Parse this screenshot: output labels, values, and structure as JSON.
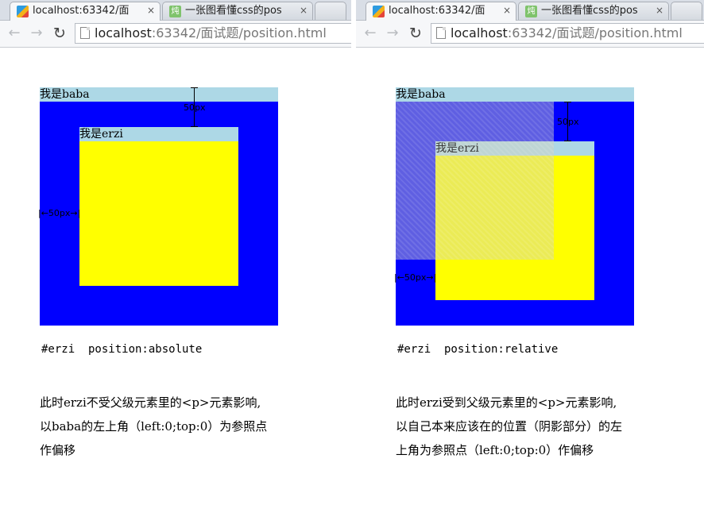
{
  "left": {
    "tabs": [
      {
        "title": "localhost:63342/面",
        "close": "×",
        "favicon": "webstorm-icon"
      },
      {
        "title": "一张图看懂css的pos",
        "close": "×",
        "favicon": "chi-icon",
        "favicon_text": "炖"
      }
    ],
    "url": {
      "host": "localhost",
      "rest": ":63342/面试题/position.html"
    },
    "baba_label": "我是baba",
    "erzi_label": "我是erzi",
    "top_measure": "50px",
    "left_measure": "|←50px→|",
    "code": "#erzi  position:absolute",
    "desc": [
      "此时erzi不受父级元素里的<p>元素影响,",
      "以baba的左上角（left:0;top:0）为参照点",
      "作偏移"
    ]
  },
  "right": {
    "tabs": [
      {
        "title": "localhost:63342/面",
        "close": "×",
        "favicon": "webstorm-icon"
      },
      {
        "title": "一张图看懂css的pos",
        "close": "×",
        "favicon": "chi-icon",
        "favicon_text": "炖"
      }
    ],
    "url": {
      "host": "localhost",
      "rest": ":63342/面试题/position.html"
    },
    "baba_label": "我是baba",
    "erzi_label": "我是erzi",
    "top_measure": "50px",
    "left_measure": "|←50px→|",
    "code": "#erzi  position:relative",
    "desc": [
      "此时erzi受到父级元素里的<p>元素影响,",
      "以自己本来应该在的位置（阴影部分）的左",
      "上角为参照点（left:0;top:0）作偏移"
    ]
  },
  "colors": {
    "baba": "#0000ff",
    "label_bar": "#add8e6",
    "erzi": "#ffff00"
  }
}
